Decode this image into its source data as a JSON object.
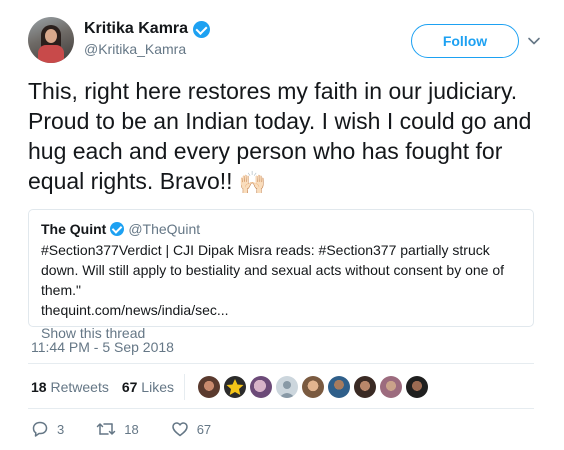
{
  "author": {
    "display_name": "Kritika Kamra",
    "handle": "@Kritika_Kamra",
    "verified": true
  },
  "follow_button": {
    "label": "Follow"
  },
  "tweet": {
    "text": "This, right here restores my faith in our judiciary. Proud to be an Indian today. I wish I could go and hug each and every person who has fought for equal rights. Bravo!!",
    "emoji": "🙌🏻"
  },
  "quoted_tweet": {
    "name": "The Quint",
    "handle": "@TheQuint",
    "verified": true,
    "text": "#Section377Verdict | CJI Dipak Misra reads: #Section377 partially struck down. Will still apply to bestiality and sexual acts without consent by one of them.\"",
    "link": "thequint.com/news/india/sec...",
    "show_thread": "Show this thread"
  },
  "timestamp": "11:44 PM - 5 Sep 2018",
  "stats": {
    "retweets_count": "18",
    "retweets_label": "Retweets",
    "likes_count": "67",
    "likes_label": "Likes"
  },
  "actions": {
    "reply_count": "3",
    "retweet_count": "18",
    "like_count": "67"
  },
  "colors": {
    "accent": "#1da1f2",
    "text": "#14171a",
    "muted": "#657786"
  },
  "icons": [
    "verified-badge-icon",
    "chevron-down-icon",
    "reply-icon",
    "retweet-icon",
    "heart-icon"
  ]
}
